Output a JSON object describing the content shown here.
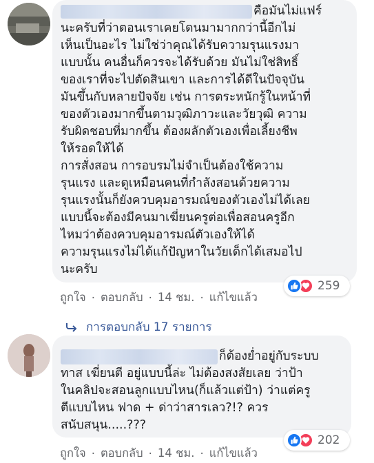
{
  "comments": [
    {
      "lines": [
        "คือมันไม่แฟร์",
        "นะครับที่ว่าตอนเราเคยโดนมามากกว่านี้อีกไม่",
        "เห็นเป็นอะไร ไม่ใช่ว่าคุณได้รับความรุนแรงมา",
        "แบบนั้น คนอื่นก็ควรจะได้รับด้วย มันไม่ใช่สิทธิ์",
        "ของเราที่จะไปตัดสินเขา และการได้ดีในปัจจุบัน",
        "มันขึ้นกับหลายปัจจัย เช่น การตระหนักรู้ในหน้าที่",
        "ของตัวเองมากขึ้นตามวุฒิภาวะและวัยวุฒิ ความ",
        "รับผิดชอบที่มากขึ้น ต้องผลักตัวเองเพื่อเลี้ยงชีพ",
        "ให้รอดให้ได้",
        "การสั่งสอน การอบรมไม่จำเป็นต้องใช้ความ",
        "รุนแรง และดูเหมือนคนที่กำลังสอนด้วยความ",
        "รุนแรงนั้นก็ยังควบคุมอารมณ์ของตัวเองไม่ได้เลย",
        "แบบนี้จะต้องมีคนมาเฆี่ยนครูต่อเพื่อสอนครูอีก",
        "ไหมว่าต้องควบคุมอารมณ์ตัวเองให้ได้",
        "ความรุนแรงไม่ได้แก้ปัญหาในวัยเด็กได้เสมอไป",
        "นะครับ"
      ],
      "reaction_count": "259",
      "actions": {
        "like": "ถูกใจ",
        "reply": "ตอบกลับ",
        "time": "14 ชม.",
        "edited": "แก้ไขแล้ว"
      }
    },
    {
      "lines": [
        "ก็ต้องย่ำอยู่กับระบบ",
        "ทาส เฆี่ยนตี อยู่แบบนี้ล่ะ ไม่ต้องสงสัยเลย ว่าป้า",
        "ในคลิปจะสอนลูกแบบไหน(ก็แล้วแต่ป้า) ว่าแต่ครู",
        "ตีแบบไหน ฟาด + ด่าว่าสารเลว?!? ควร",
        "สนับสนุน.....???"
      ],
      "reaction_count": "202",
      "actions": {
        "like": "ถูกใจ",
        "reply": "ตอบกลับ",
        "time": "14 ชม.",
        "edited": "แก้ไขแล้ว"
      }
    }
  ],
  "replies_link": "การตอบกลับ 17 รายการ",
  "separator": "·",
  "colors": {
    "like": "#1877f2",
    "love": "#f33e58",
    "link": "#385898",
    "meta": "#65676b",
    "bubble": "#f2f3f5"
  }
}
